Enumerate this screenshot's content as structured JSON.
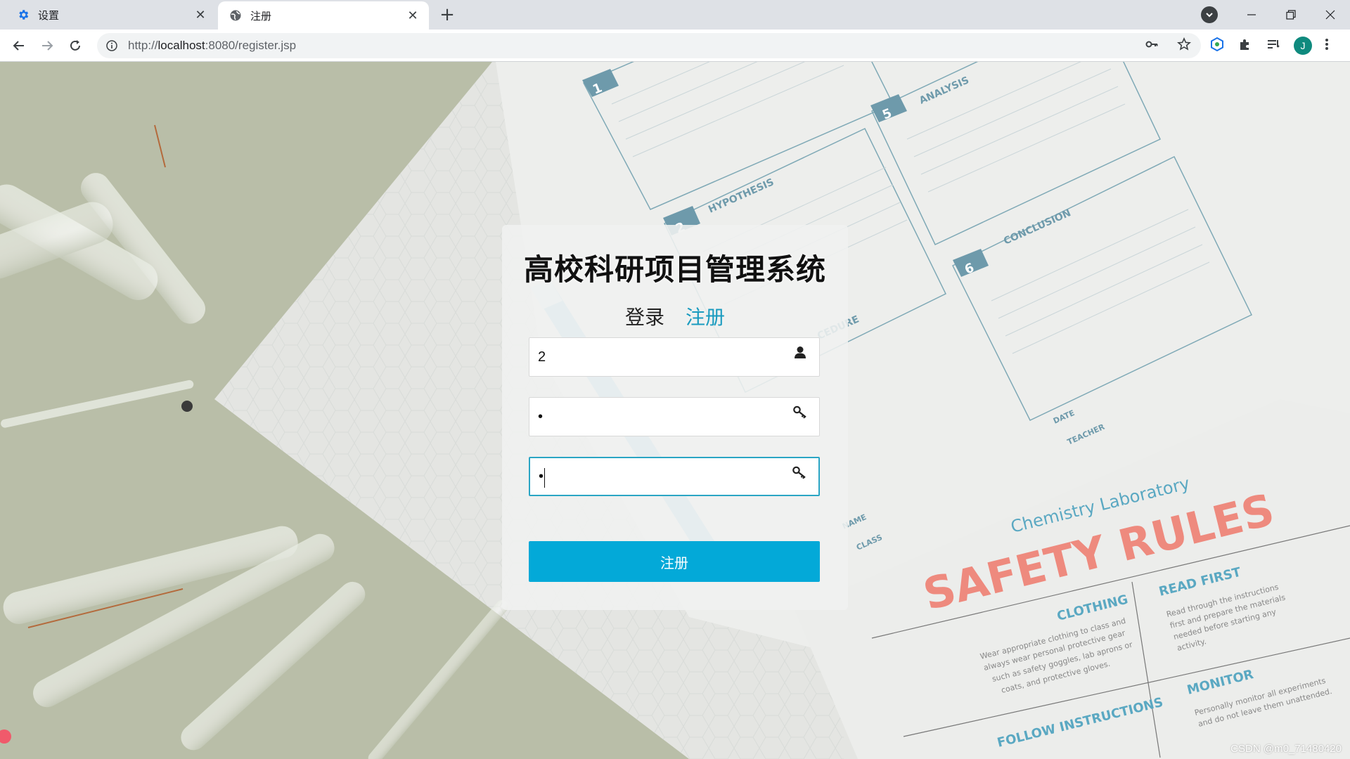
{
  "browser": {
    "tabs": [
      {
        "title": "设置",
        "icon": "gear-icon"
      },
      {
        "title": "注册",
        "icon": "globe-icon"
      }
    ],
    "url_prefix": "http://",
    "url_host": "localhost",
    "url_rest": ":8080/register.jsp",
    "avatar_letter": "J"
  },
  "colors": {
    "accent": "#03a9d8",
    "active_tab": "#1a9bbf"
  },
  "form": {
    "system_title": "高校科研项目管理系统",
    "tab_login": "登录",
    "tab_register": "注册",
    "username_value": "2",
    "password_value": "•",
    "confirm_value": "•",
    "submit_label": "注册"
  },
  "footer": {
    "watermark": "CSDN @m0_71480420"
  }
}
